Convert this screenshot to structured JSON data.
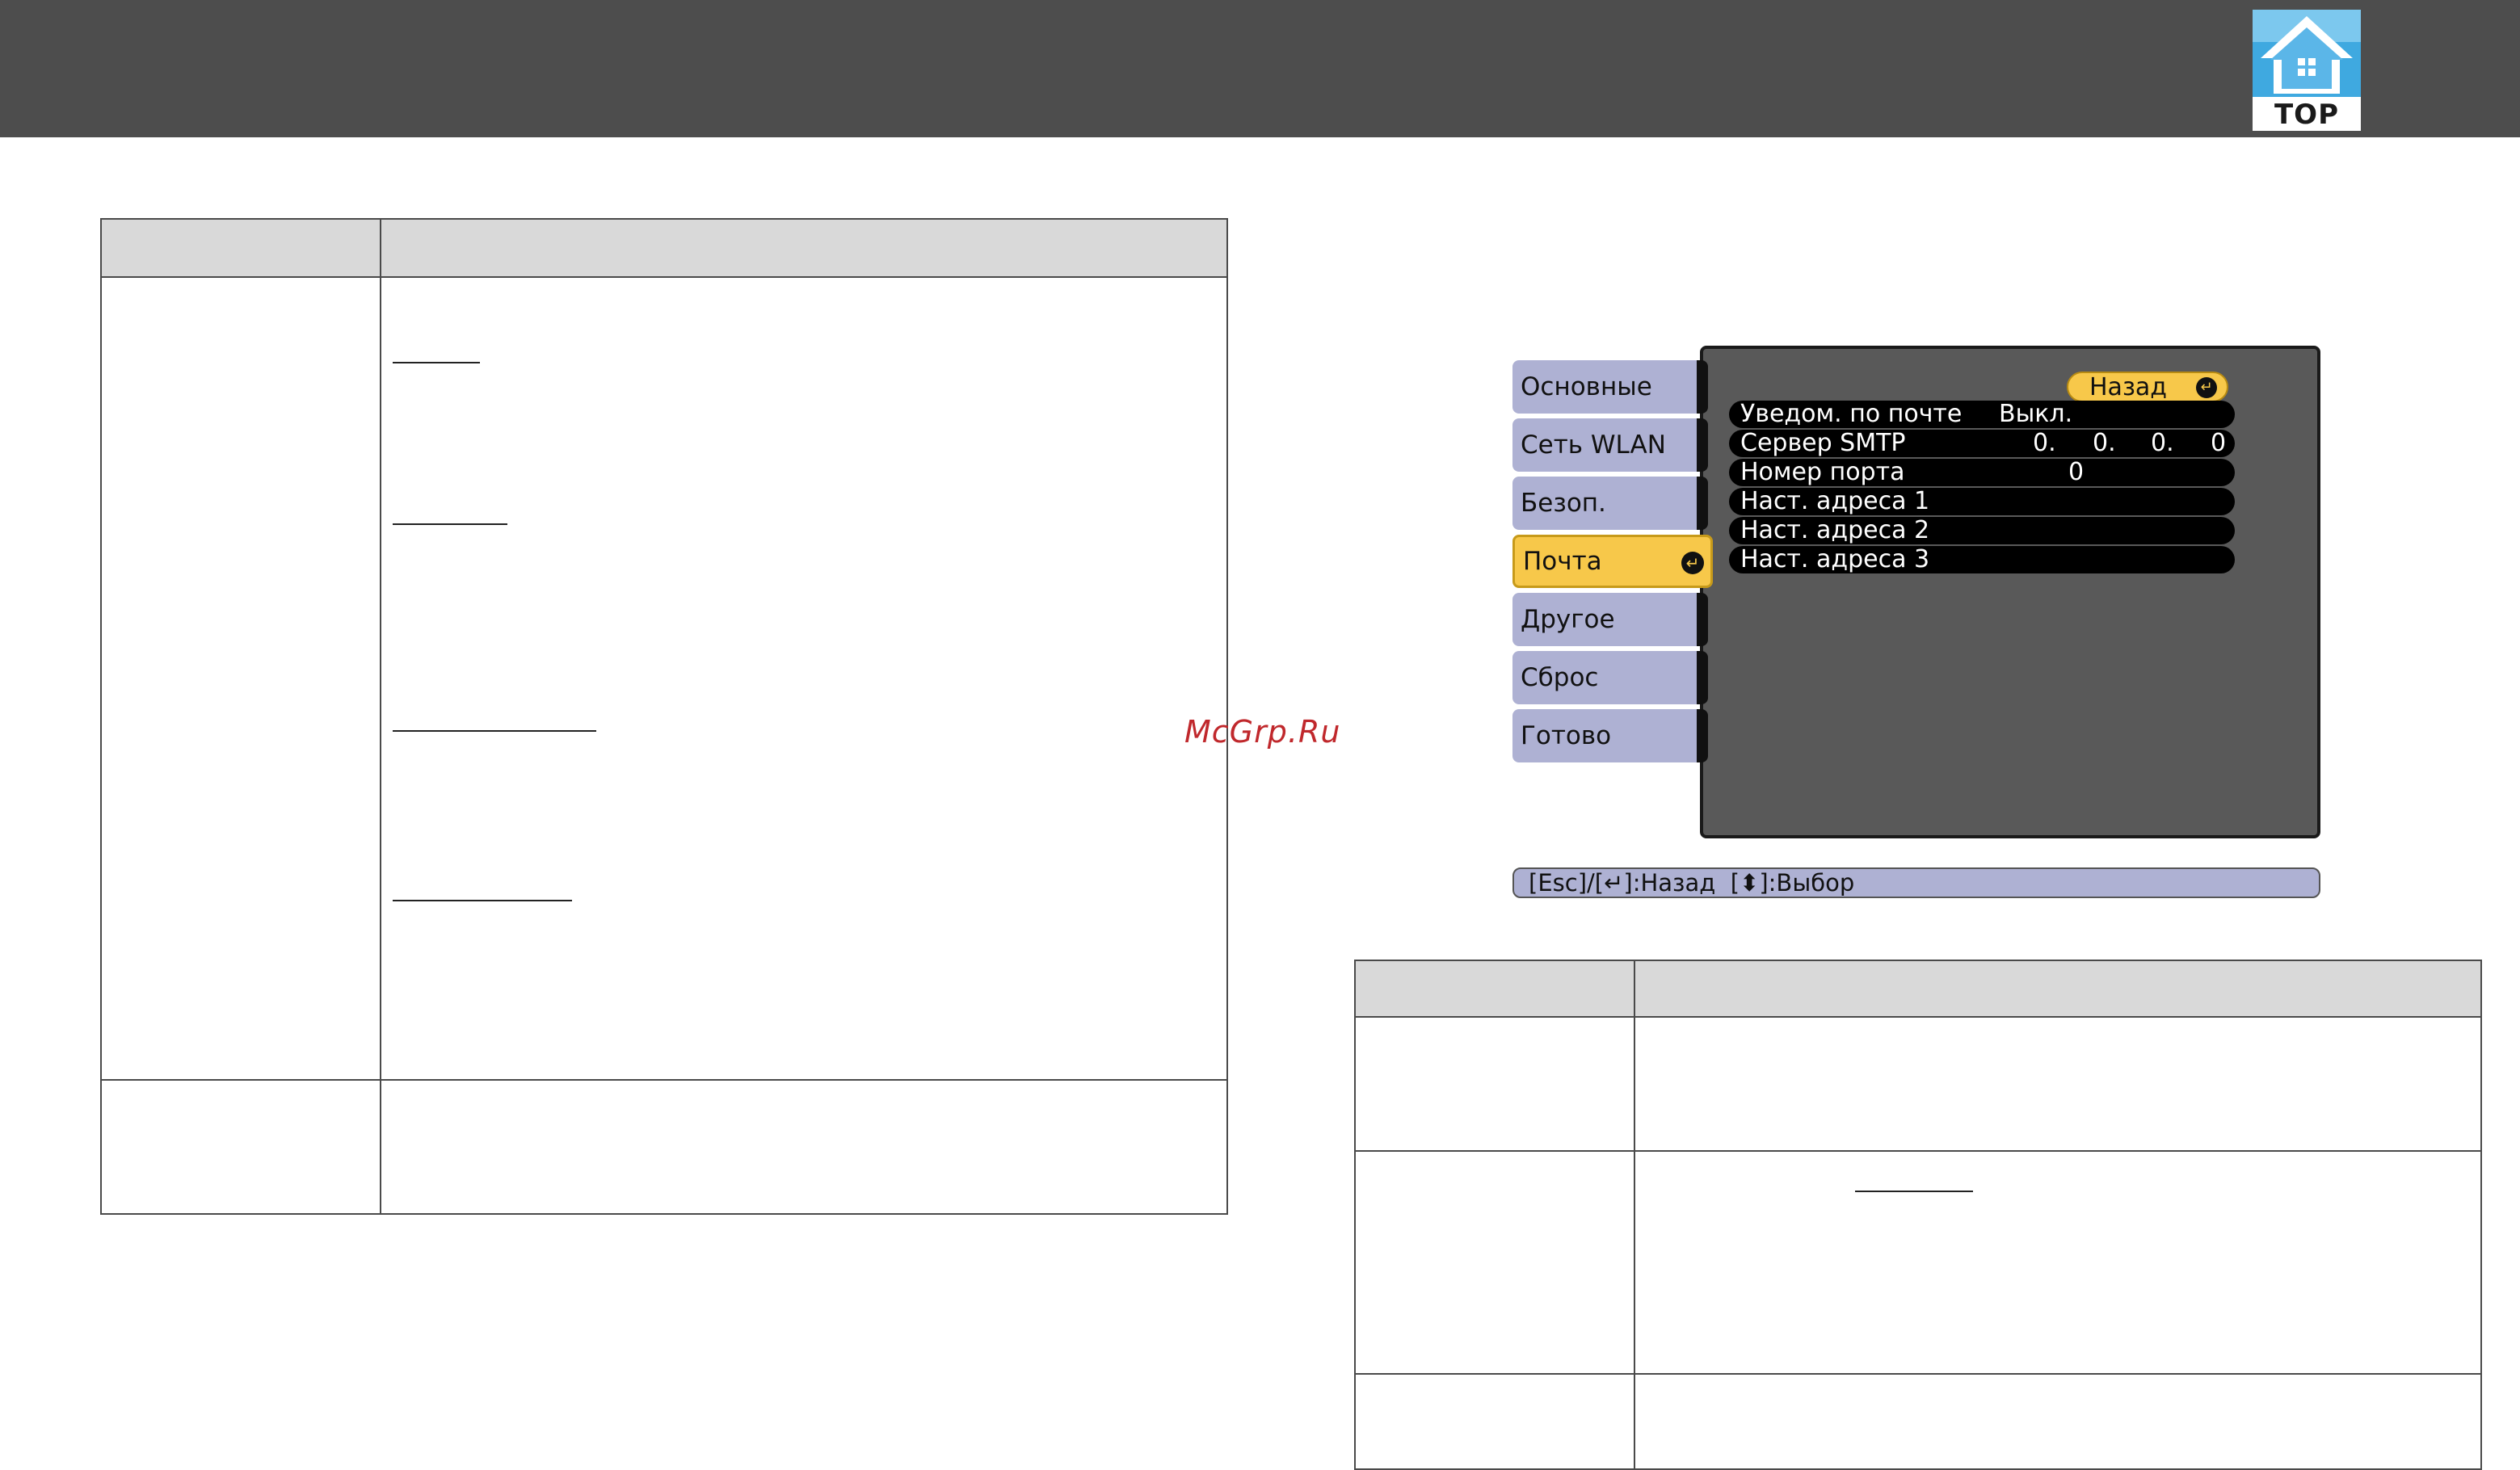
{
  "header": {
    "logo_text": "TOP"
  },
  "watermark": "McGrp.Ru",
  "projector_menu": {
    "menu_items": [
      {
        "label": "Основные",
        "active": false
      },
      {
        "label": "Сеть WLAN",
        "active": false
      },
      {
        "label": "Безоп.",
        "active": false
      },
      {
        "label": "Почта",
        "active": true
      },
      {
        "label": "Другое",
        "active": false
      },
      {
        "label": "Сброс",
        "active": false
      },
      {
        "label": "Готово",
        "active": false
      }
    ],
    "back_label": "Назад",
    "enter_symbol": "↵",
    "settings": [
      {
        "label": "Уведом. по почте",
        "value": "Выкл."
      },
      {
        "label": "Сервер SMTP",
        "value_parts": [
          "0.",
          "0.",
          "0.",
          "0"
        ]
      },
      {
        "label": "Номер порта",
        "value": "0"
      },
      {
        "label": "Наст. адреса 1",
        "value": ""
      },
      {
        "label": "Наст. адреса 2",
        "value": ""
      },
      {
        "label": "Наст. адреса 3",
        "value": ""
      }
    ],
    "status_bar": "[Esc]/[↵]:Назад  [⬍]:Выбор"
  },
  "colors": {
    "header_bg": "#4d4d4d",
    "menu_item_bg": "#aeb1d3",
    "menu_active_bg": "#f7c84a",
    "panel_bg": "#595959",
    "watermark": "#c0282c",
    "logo_blue": "#3fa9e0"
  }
}
